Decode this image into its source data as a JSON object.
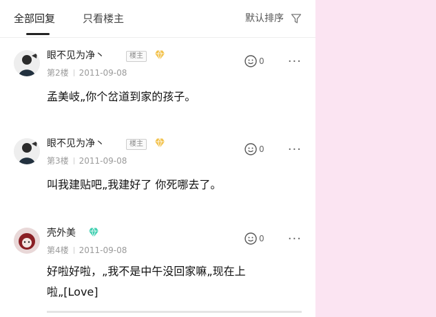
{
  "tabs": {
    "all": "全部回复",
    "owner_only": "只看楼主"
  },
  "sort": {
    "label": "默认排序"
  },
  "posts": [
    {
      "author": "眼不见为净丶",
      "owner_badge": "楼主",
      "floor": "第2楼",
      "date": "2011-09-08",
      "likes": "0",
      "content": "孟美岐„你个岔道到家的孩子。"
    },
    {
      "author": "眼不见为净丶",
      "owner_badge": "楼主",
      "floor": "第3楼",
      "date": "2011-09-08",
      "likes": "0",
      "content": "叫我建贴吧„我建好了 你死哪去了。"
    },
    {
      "author": "壳外美",
      "floor": "第4楼",
      "date": "2011-09-08",
      "likes": "0",
      "content_line1": "好啦好啦，„我不是中午没回家嘛„现在上",
      "content_line2": "啦„[Love]"
    }
  ],
  "more_label": "···",
  "colors": {
    "gem_gold": "#f2c14a",
    "gem_teal": "#3fcfb0",
    "side_bg": "#fbe4f2"
  }
}
